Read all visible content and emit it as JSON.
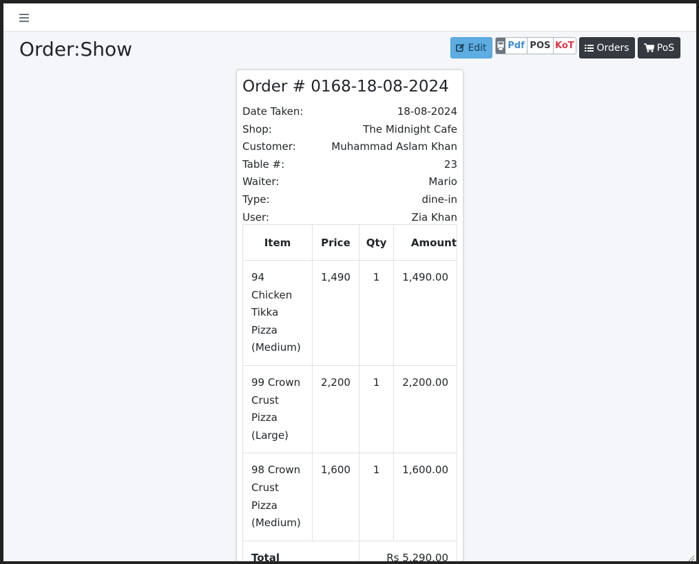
{
  "page": {
    "title": "Order:Show"
  },
  "toolbar": {
    "edit_label": "Edit",
    "print": {
      "pdf": "Pdf",
      "pos": "POS",
      "kot": "KoT"
    },
    "orders_label": "Orders",
    "pos_label": "PoS"
  },
  "order": {
    "heading": "Order # 0168-18-08-2024",
    "meta": [
      {
        "label": "Date Taken:",
        "value": "18-08-2024"
      },
      {
        "label": "Shop:",
        "value": "The Midnight Cafe"
      },
      {
        "label": "Customer:",
        "value": "Muhammad Aslam Khan"
      },
      {
        "label": "Table #:",
        "value": "23"
      },
      {
        "label": "Waiter:",
        "value": "Mario"
      },
      {
        "label": "Type:",
        "value": "dine-in"
      },
      {
        "label": "User:",
        "value": "Zia Khan"
      }
    ],
    "table": {
      "headers": [
        "Item",
        "Price",
        "Qty",
        "Amount"
      ],
      "rows": [
        {
          "item": "94 Chicken Tikka Pizza (Medium)",
          "price": "1,490",
          "qty": "1",
          "amount": "1,490.00"
        },
        {
          "item": "99 Crown Crust Pizza (Large)",
          "price": "2,200",
          "qty": "1",
          "amount": "2,200.00"
        },
        {
          "item": "98 Crown Crust Pizza (Medium)",
          "price": "1,600",
          "qty": "1",
          "amount": "1,600.00"
        }
      ],
      "total_label": "Total",
      "total_amount": "Rs 5,290.00"
    }
  },
  "icons": {
    "menu": "hamburger-icon",
    "edit": "edit-icon",
    "print": "print-icon",
    "orders": "list-icon",
    "pos": "cart-icon"
  }
}
